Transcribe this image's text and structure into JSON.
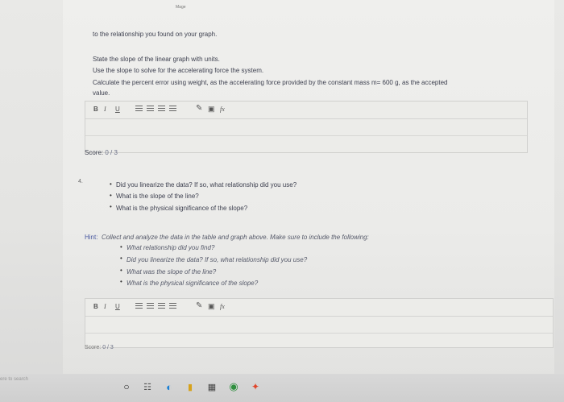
{
  "header_mark": "Mage",
  "intro_line": "to the relationship you found on your graph.",
  "instructions": [
    "State the slope of the linear graph with units.",
    "Use the slope to solve for the accelerating force the system.",
    "Calculate the percent error using weight, as the accelerating force provided by the constant mass m= 600 g, as the accepted",
    "value."
  ],
  "toolbar": {
    "bold": "B",
    "italic": "I",
    "underline": "U",
    "formula": "fx"
  },
  "score1": {
    "label": "Score:",
    "value": "0 / 3"
  },
  "question": {
    "number": "4.",
    "bullets": [
      "Did you linearize the data? If so, what relationship did you use?",
      "What is the slope of the line?",
      "What is the physical significance of the slope?"
    ]
  },
  "hint": {
    "label": "Hint:",
    "text": "Collect and analyze the data in the table and graph above. Make sure to include the following:",
    "bullets": [
      "What relationship did you find?",
      "Did you linearize the data? If so, what relationship did you use?",
      "What was the slope of the line?",
      "What is the physical significance of the slope?"
    ]
  },
  "score2": {
    "label": "Score:",
    "value": "0 / 3"
  },
  "taskbar": {
    "search_hint": "ere to search"
  },
  "colors": {
    "page_bg": "#efefed",
    "text": "#3e4150",
    "taskbar": "#d3d3d3"
  }
}
